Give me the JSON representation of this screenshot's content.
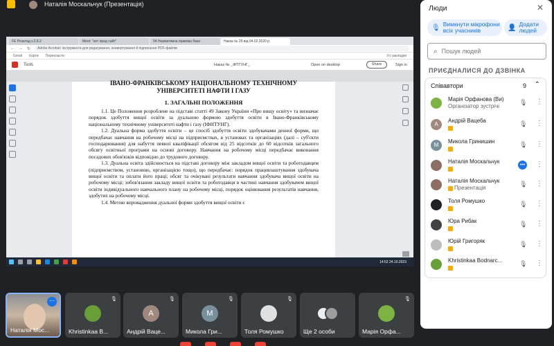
{
  "topbar": {
    "title": "Наталія Москальчук (Презентація)"
  },
  "browser": {
    "tabs": [
      "FE Розклад v.3.8.2",
      "Meet: \"нет пред сайт\"",
      "04 Нормативна правова база",
      "Наказ № 29 від 04.02.2020 р."
    ],
    "url": "Adobe Acrobat: інструменти для редагування, конвертування й підписання PDF-файлів",
    "bookmarks": [
      "Gmail",
      "Карти",
      "Перекласти",
      "Усі закладки"
    ],
    "acrobat_tools": "Tools",
    "acrobat_file": "Наказ № _ФПТУНГ_",
    "acrobat_open": "Open on desktop",
    "acrobat_share": "Share",
    "acrobat_sign": "Sign in",
    "taskbar_time": "14:52\n24.10.2023"
  },
  "document": {
    "head1": "ІВАНО-ФРАНКІВСЬКОМУ НАЦІОНАЛЬНОМУ ТЕХНІЧНОМУ",
    "head2": "УНІВЕРСИТЕТІ НАФТИ І ГАЗУ",
    "section": "1. ЗАГАЛЬНІ ПОЛОЖЕННЯ",
    "p1": "1.1. Це Положення розроблене на підставі статті 49 Закону України «Про вищу освіту» та визначає порядок здобуття вищої освіти за дуальною формою здобуття освіти в Івано-Франківському національному технічному університеті нафти і газу (ІФНТУНГ).",
    "p2": "1.2. Дуальна форма здобуття освіти – це спосіб здобуття освіти здобувачами денної форми, що передбачає навчання на робочому місці на підприємствах, в установах та організаціях (далі – суб'єкти господарювання) для набуття певної кваліфікації обсягом від 25 відсотків до 60 відсотків загального обсягу освітньої програми на основі договору. Навчання на робочому місці передбачає виконання посадових обов'язків відповідно до трудового договору.",
    "p3": "1.3. Дуальна освіта здійснюється на підставі договору між закладом вищої освіти та роботодавцем (підприємством, установою, організацією тощо), що передбачає: порядок працевлаштування здобувача вищої освіти та оплати його праці; обсяг та очікувані результати навчання здобувача вищої освіти на робочому місці; зобов'язання закладу вищої освіти та роботодавця в частині навчання здобувачем вищої освіти індивідуального навчального плану на робочому місці, порядок оцінювання результатів навчання, здобутих на робочому місці.",
    "p4": "1.4. Метою впровадження дуальної форми здобуття вищої освіти є"
  },
  "tiles": [
    {
      "name": "Наталія Мос...",
      "initial": "",
      "color": "#8d6e63"
    },
    {
      "name": "Khristinkaa B...",
      "initial": "",
      "color": "#689f38"
    },
    {
      "name": "Андрій Ваце...",
      "initial": "А",
      "color": "#a1887f"
    },
    {
      "name": "Микола Гри...",
      "initial": "М",
      "color": "#78909c"
    },
    {
      "name": "Толя Ромушко",
      "initial": "",
      "color": "#5f6368"
    },
    {
      "name": "Ще 2 особи",
      "initial": "",
      "color": "#5f6368"
    },
    {
      "name": "Марія Орфа...",
      "initial": "",
      "color": "#7cb342"
    }
  ],
  "panel": {
    "title": "Люди",
    "mute_all": "Вимкнути мікрофони всіх учасників",
    "add_people": "Додати людей",
    "search_placeholder": "Пошук людей",
    "section_title": "ПРИЄДНАЛИСЯ ДО ДЗВІНКА",
    "group_label": "Співавтори",
    "group_count": "9",
    "people": [
      {
        "name": "Марія Орфанова (Ви)",
        "sub": "Організатор зустрічі",
        "initial": "",
        "color": "#7cb342",
        "mic": "muted"
      },
      {
        "name": "Андрій Вацеба",
        "sub": "",
        "initial": "А",
        "color": "#a1887f",
        "mic": "muted"
      },
      {
        "name": "Микола Гринишин",
        "sub": "",
        "initial": "М",
        "color": "#78909c",
        "mic": "muted"
      },
      {
        "name": "Наталія Москальчук",
        "sub": "",
        "initial": "",
        "color": "#8d6e63",
        "mic": "active"
      },
      {
        "name": "Наталія Москальчук",
        "sub": "Презентація",
        "initial": "",
        "color": "#8d6e63",
        "mic": "muted"
      },
      {
        "name": "Толя Ромушко",
        "sub": "",
        "initial": "",
        "color": "#202124",
        "mic": "muted"
      },
      {
        "name": "Юра Рибак",
        "sub": "",
        "initial": "",
        "color": "#424242",
        "mic": "muted"
      },
      {
        "name": "Юрій Григоряк",
        "sub": "",
        "initial": "",
        "color": "#bdbdbd",
        "mic": "muted"
      },
      {
        "name": "Khristinkaa Bodnarc...",
        "sub": "",
        "initial": "",
        "color": "#689f38",
        "mic": "muted"
      }
    ]
  }
}
